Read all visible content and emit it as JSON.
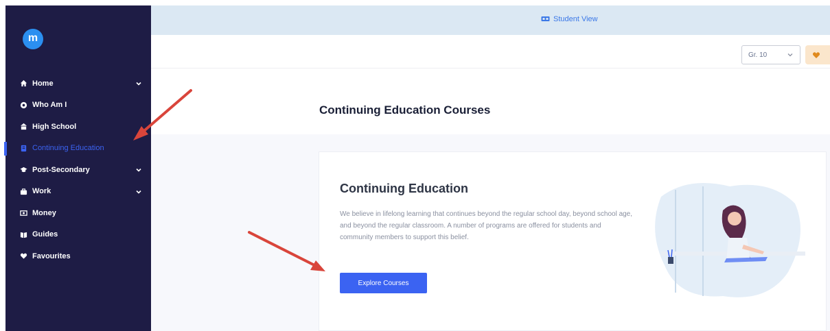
{
  "app": {
    "logo_letter": "m"
  },
  "sidebar": {
    "items": [
      {
        "label": "Home",
        "icon": "home-icon",
        "has_chevron": true,
        "active": false
      },
      {
        "label": "Who Am I",
        "icon": "target-icon",
        "has_chevron": false,
        "active": false
      },
      {
        "label": "High School",
        "icon": "school-icon",
        "has_chevron": false,
        "active": false
      },
      {
        "label": "Continuing Education",
        "icon": "book-icon",
        "has_chevron": false,
        "active": true
      },
      {
        "label": "Post-Secondary",
        "icon": "graduation-cap-icon",
        "has_chevron": true,
        "active": false
      },
      {
        "label": "Work",
        "icon": "briefcase-icon",
        "has_chevron": true,
        "active": false
      },
      {
        "label": "Money",
        "icon": "money-icon",
        "has_chevron": false,
        "active": false
      },
      {
        "label": "Guides",
        "icon": "guide-book-icon",
        "has_chevron": false,
        "active": false
      },
      {
        "label": "Favourites",
        "icon": "heart-icon",
        "has_chevron": false,
        "active": false
      }
    ]
  },
  "header": {
    "student_view_label": "Student View",
    "grade_select_value": "Gr. 10"
  },
  "page": {
    "title": "Continuing Education Courses",
    "card": {
      "title": "Continuing Education",
      "description": "We believe in lifelong learning that continues beyond the regular school day, beyond school age, and beyond the regular classroom. A number of programs are offered for students and community members to support this belief.",
      "button_label": "Explore Courses"
    }
  },
  "colors": {
    "sidebar_bg": "#1e1c45",
    "accent": "#3b63f2",
    "topbar_bg": "#dbe8f3",
    "annotation_arrow": "#d9453b"
  }
}
